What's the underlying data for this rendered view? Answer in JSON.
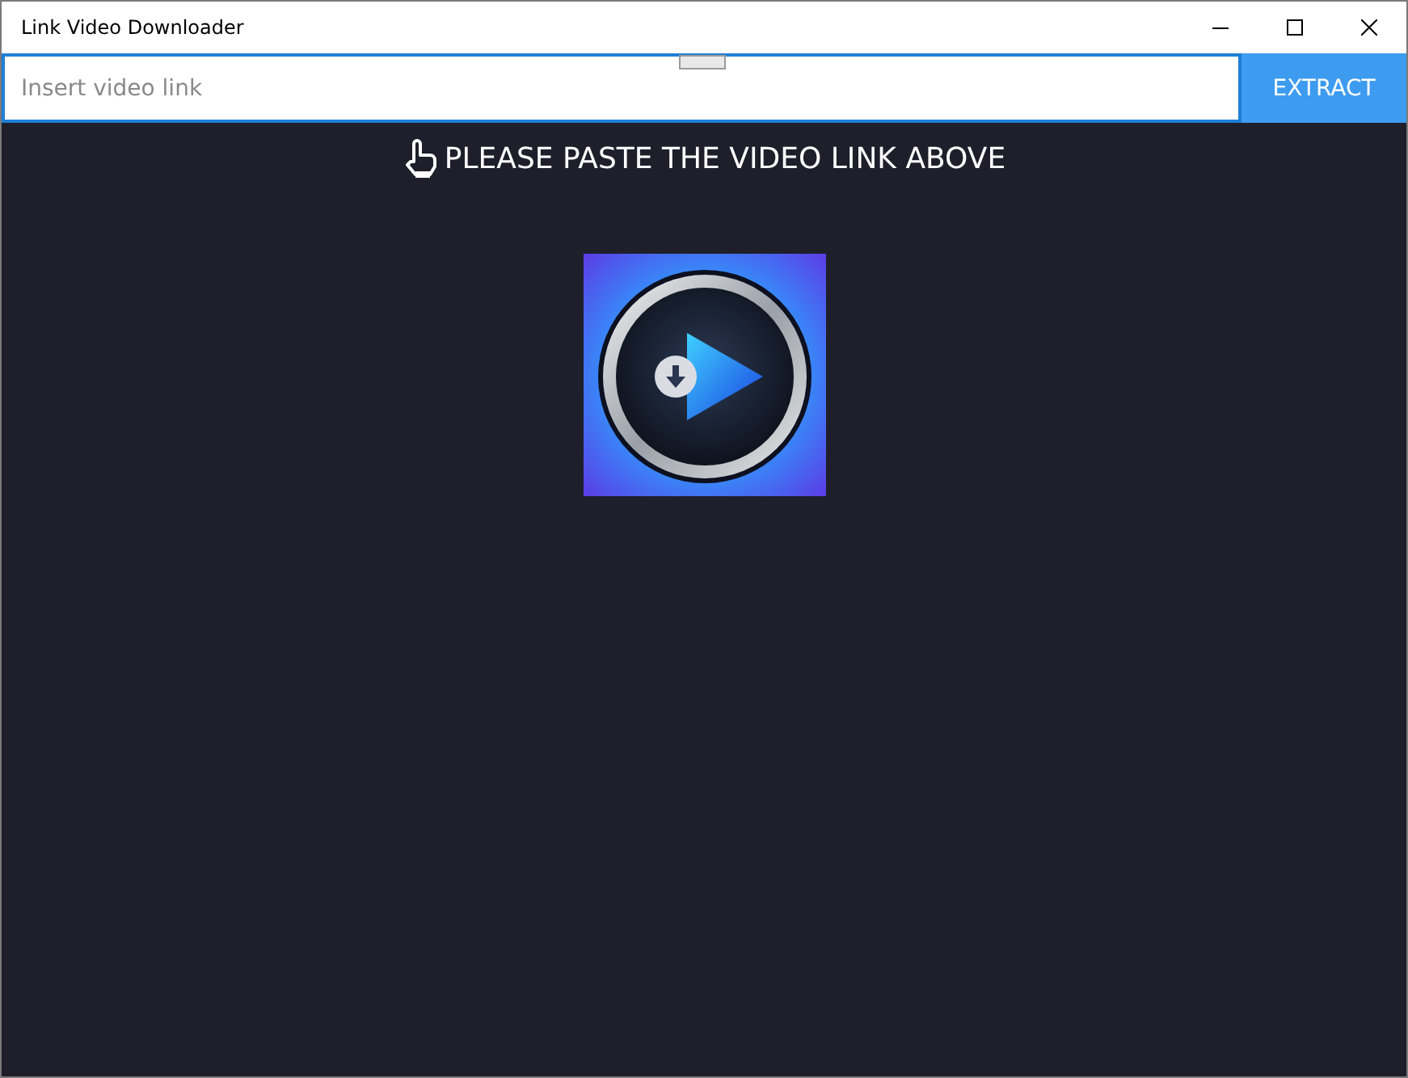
{
  "window": {
    "title": "Link Video Downloader"
  },
  "link_bar": {
    "placeholder": "Insert video link",
    "button": "EXTRACT"
  },
  "prompt": "PLEASE PASTE THE VIDEO LINK ABOVE"
}
